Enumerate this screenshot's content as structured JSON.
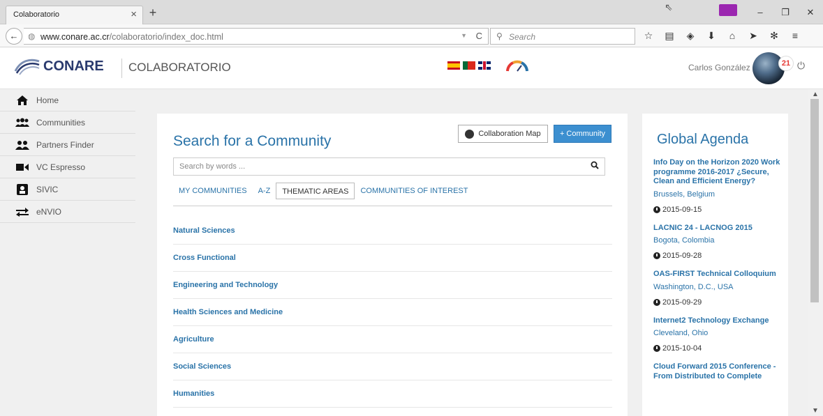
{
  "browser": {
    "tab_title": "Colaboratorio",
    "url_domain": "www.conare.ac.cr",
    "url_path": "/colaboratorio/index_doc.html",
    "search_placeholder": "Search"
  },
  "header": {
    "logo_text": "CONARE",
    "app_name": "COLABORATORIO",
    "user_name": "Carlos González",
    "notification_count": "21"
  },
  "sidebar": {
    "items": [
      {
        "label": "Home",
        "icon": "home-icon"
      },
      {
        "label": "Communities",
        "icon": "group-icon"
      },
      {
        "label": "Partners Finder",
        "icon": "partners-icon"
      },
      {
        "label": "VC Espresso",
        "icon": "video-camera-icon"
      },
      {
        "label": "SIVIC",
        "icon": "sivic-icon"
      },
      {
        "label": "eNVIO",
        "icon": "exchange-icon"
      }
    ]
  },
  "main": {
    "title": "Search for a Community",
    "map_button": "Collaboration Map",
    "add_button": "+ Community",
    "search_placeholder": "Search by words ...",
    "tabs": [
      "MY COMMUNITIES",
      "A-Z",
      "THEMATIC AREAS",
      "COMMUNITIES OF INTEREST"
    ],
    "active_tab": "THEMATIC AREAS",
    "areas": [
      "Natural Sciences",
      "Cross Functional",
      "Engineering and Technology",
      "Health Sciences and Medicine",
      "Agriculture",
      "Social Sciences",
      "Humanities"
    ]
  },
  "agenda": {
    "title": "Global Agenda",
    "events": [
      {
        "title": "Info Day on the Horizon 2020 Work programme 2016-2017 ¿Secure, Clean and Efficient Energy?",
        "place": "Brussels, Belgium",
        "date": "2015-09-15"
      },
      {
        "title": "LACNIC 24 - LACNOG 2015",
        "place": "Bogota, Colombia",
        "date": "2015-09-28"
      },
      {
        "title": "OAS-FIRST Technical Colloquium",
        "place": "Washington, D.C., USA",
        "date": "2015-09-29"
      },
      {
        "title": "Internet2 Technology Exchange",
        "place": "Cleveland, Ohio",
        "date": "2015-10-04"
      },
      {
        "title": "Cloud Forward 2015 Conference - From Distributed to Complete",
        "place": "",
        "date": ""
      }
    ]
  },
  "colors": {
    "link_blue": "#2a73a8",
    "button_blue": "#3c8fd0",
    "badge_red": "#e53935"
  }
}
